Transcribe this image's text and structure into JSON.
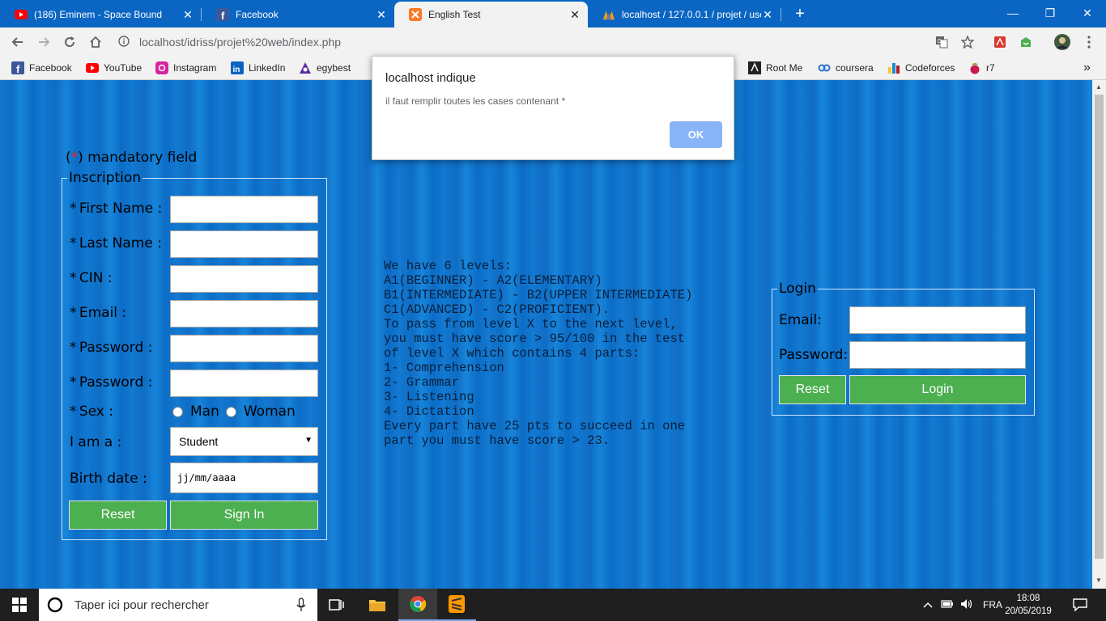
{
  "browser": {
    "tabs": [
      {
        "title": "(186) Eminem - Space Bound",
        "icon": "youtube-icon"
      },
      {
        "title": "Facebook",
        "icon": "facebook-icon"
      },
      {
        "title": "English Test",
        "icon": "xampp-icon",
        "active": true
      },
      {
        "title": "localhost / 127.0.0.1 / projet / use",
        "icon": "phpmyadmin-icon"
      }
    ],
    "close_glyph": "✕",
    "new_tab_glyph": "+",
    "window_controls": {
      "minimize": "—",
      "restore": "❐",
      "close": "✕"
    },
    "url": "localhost/idriss/projet%20web/index.php",
    "bookmarks": [
      {
        "label": "Facebook",
        "icon": "facebook-icon"
      },
      {
        "label": "YouTube",
        "icon": "youtube-icon"
      },
      {
        "label": "Instagram",
        "icon": "instagram-icon"
      },
      {
        "label": "LinkedIn",
        "icon": "linkedin-icon"
      },
      {
        "label": "egybest",
        "icon": "egybest-icon"
      },
      {
        "label": "Root Me",
        "icon": "rootme-icon"
      },
      {
        "label": "coursera",
        "icon": "coursera-icon"
      },
      {
        "label": "Codeforces",
        "icon": "codeforces-icon"
      },
      {
        "label": "r7",
        "icon": "raspberry-icon"
      }
    ],
    "more_bookmarks_glyph": "»"
  },
  "dialog": {
    "title": "localhost indique",
    "message": "il faut remplir toutes les cases contenant *",
    "ok_label": "OK"
  },
  "page": {
    "mandatory_note": {
      "open": "(",
      "star": "*",
      "close": ") mandatory field"
    },
    "inscription": {
      "legend": "Inscription",
      "star": "*",
      "first_name_label": "First Name :",
      "last_name_label": "Last Name :",
      "cin_label": "CIN :",
      "email_label": "Email :",
      "password_label": "Password :",
      "password2_label": "Password :",
      "sex_label": "Sex :",
      "sex_man": "Man",
      "sex_woman": "Woman",
      "role_label": "I am a :",
      "role_value": "Student",
      "birth_label": "Birth date :",
      "birth_placeholder": "jj/mm/aaaa",
      "reset_label": "Reset",
      "signin_label": "Sign In"
    },
    "levels_text": "We have 6 levels:\nA1(BEGINNER) - A2(ELEMENTARY)\nB1(INTERMEDIATE) - B2(UPPER INTERMEDIATE)\nC1(ADVANCED) - C2(PROFICIENT).\nTo pass from level X to the next level,\nyou must have score > 95/100 in the test\nof level X which contains 4 parts:\n1- Comprehension\n2- Grammar\n3- Listening\n4- Dictation\nEvery part have 25 pts to succeed in one\npart you must have score > 23.",
    "login": {
      "legend": "Login",
      "email_label": "Email:",
      "password_label": "Password:",
      "reset_label": "Reset",
      "login_label": "Login"
    }
  },
  "taskbar": {
    "search_placeholder": "Taper ici pour rechercher",
    "language": "FRA",
    "time": "18:08",
    "date": "20/05/2019"
  }
}
